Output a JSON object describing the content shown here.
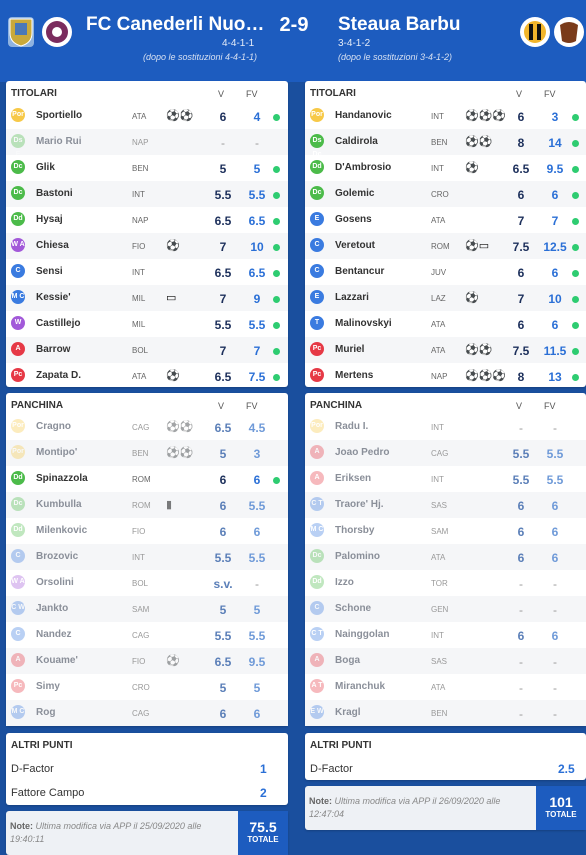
{
  "match": {
    "home": {
      "name": "FC Canederli Nuo…",
      "formation": "4-4-1-1",
      "after_sub": "(dopo le sostituzioni 4-4-1-1)"
    },
    "away": {
      "name": "Steaua Barbu",
      "formation": "3-4-1-2",
      "after_sub": "(dopo le sostituzioni 3-4-1-2)"
    },
    "score": "2-9"
  },
  "labels": {
    "titolari": "TITOLARI",
    "panchina": "PANCHINA",
    "v": "V",
    "fv": "FV",
    "altri_punti": "ALTRI PUNTI",
    "totale": "TOTALE",
    "note_label": "Note:"
  },
  "home_starters": [
    {
      "role": "Por",
      "name": "Sportiello",
      "club": "ATA",
      "icons": "⚽⚽",
      "v": "6",
      "fv": "4",
      "played": true
    },
    {
      "role": "Ds E",
      "name": "Mario Rui",
      "club": "NAP",
      "icons": "",
      "v": "-",
      "fv": "-",
      "played": false
    },
    {
      "role": "Dc",
      "name": "Glik",
      "club": "BEN",
      "icons": "",
      "v": "5",
      "fv": "5",
      "played": true
    },
    {
      "role": "Dc",
      "name": "Bastoni",
      "club": "INT",
      "icons": "",
      "v": "5.5",
      "fv": "5.5",
      "played": true
    },
    {
      "role": "Dd Ds",
      "name": "Hysaj",
      "club": "NAP",
      "icons": "",
      "v": "6.5",
      "fv": "6.5",
      "played": true
    },
    {
      "role": "W A",
      "name": "Chiesa",
      "club": "FIO",
      "icons": "⚽",
      "v": "7",
      "fv": "10",
      "played": true
    },
    {
      "role": "C",
      "name": "Sensi",
      "club": "INT",
      "icons": "",
      "v": "6.5",
      "fv": "6.5",
      "played": true
    },
    {
      "role": "M C",
      "name": "Kessie'",
      "club": "MIL",
      "icons": "▭",
      "v": "7",
      "fv": "9",
      "played": true
    },
    {
      "role": "W",
      "name": "Castillejo",
      "club": "MIL",
      "icons": "",
      "v": "5.5",
      "fv": "5.5",
      "played": true
    },
    {
      "role": "A",
      "name": "Barrow",
      "club": "BOL",
      "icons": "",
      "v": "7",
      "fv": "7",
      "played": true
    },
    {
      "role": "Pc",
      "name": "Zapata D.",
      "club": "ATA",
      "icons": "⚽",
      "v": "6.5",
      "fv": "7.5",
      "played": true
    }
  ],
  "away_starters": [
    {
      "role": "Por",
      "name": "Handanovic",
      "club": "INT",
      "icons": "⚽⚽⚽",
      "v": "6",
      "fv": "3",
      "played": true
    },
    {
      "role": "Ds Dc",
      "name": "Caldirola",
      "club": "BEN",
      "icons": "⚽⚽",
      "v": "8",
      "fv": "14",
      "played": true
    },
    {
      "role": "Dd Dc E",
      "name": "D'Ambrosio",
      "club": "INT",
      "icons": "⚽",
      "v": "6.5",
      "fv": "9.5",
      "played": true
    },
    {
      "role": "Dc",
      "name": "Golemic",
      "club": "CRO",
      "icons": "",
      "v": "6",
      "fv": "6",
      "played": true
    },
    {
      "role": "E",
      "name": "Gosens",
      "club": "ATA",
      "icons": "",
      "v": "7",
      "fv": "7",
      "played": true
    },
    {
      "role": "C",
      "name": "Veretout",
      "club": "ROM",
      "icons": "⚽▭",
      "v": "7.5",
      "fv": "12.5",
      "played": true
    },
    {
      "role": "C",
      "name": "Bentancur",
      "club": "JUV",
      "icons": "",
      "v": "6",
      "fv": "6",
      "played": true
    },
    {
      "role": "E",
      "name": "Lazzari",
      "club": "LAZ",
      "icons": "⚽",
      "v": "7",
      "fv": "10",
      "played": true
    },
    {
      "role": "T",
      "name": "Malinovskyi",
      "club": "ATA",
      "icons": "",
      "v": "6",
      "fv": "6",
      "played": true
    },
    {
      "role": "Pc",
      "name": "Muriel",
      "club": "ATA",
      "icons": "⚽⚽",
      "v": "7.5",
      "fv": "11.5",
      "played": true
    },
    {
      "role": "Pc",
      "name": "Mertens",
      "club": "NAP",
      "icons": "⚽⚽⚽",
      "v": "8",
      "fv": "13",
      "played": true
    }
  ],
  "home_bench": [
    {
      "role": "Por",
      "name": "Cragno",
      "club": "CAG",
      "icons": "⚽⚽",
      "v": "6.5",
      "fv": "4.5",
      "played": false
    },
    {
      "role": "Por",
      "name": "Montipo'",
      "club": "BEN",
      "icons": "⚽⚽",
      "v": "5",
      "fv": "3",
      "played": false
    },
    {
      "role": "Dd Ds",
      "name": "Spinazzola",
      "club": "ROM",
      "icons": "",
      "v": "6",
      "fv": "6",
      "played": true
    },
    {
      "role": "Dc",
      "name": "Kumbulla",
      "club": "ROM",
      "icons": "▮",
      "v": "6",
      "fv": "5.5",
      "played": false
    },
    {
      "role": "Dd",
      "name": "Milenkovic",
      "club": "FIO",
      "icons": "",
      "v": "6",
      "fv": "6",
      "played": false
    },
    {
      "role": "C",
      "name": "Brozovic",
      "club": "INT",
      "icons": "",
      "v": "5.5",
      "fv": "5.5",
      "played": false
    },
    {
      "role": "W A",
      "name": "Orsolini",
      "club": "BOL",
      "icons": "",
      "v": "s.v.",
      "fv": "-",
      "played": false
    },
    {
      "role": "C W",
      "name": "Jankto",
      "club": "SAM",
      "icons": "",
      "v": "5",
      "fv": "5",
      "played": false
    },
    {
      "role": "C",
      "name": "Nandez",
      "club": "CAG",
      "icons": "",
      "v": "5.5",
      "fv": "5.5",
      "played": false
    },
    {
      "role": "A",
      "name": "Kouame'",
      "club": "FIO",
      "icons": "⚽",
      "v": "6.5",
      "fv": "9.5",
      "played": false
    },
    {
      "role": "Pc",
      "name": "Simy",
      "club": "CRO",
      "icons": "",
      "v": "5",
      "fv": "5",
      "played": false
    },
    {
      "role": "M C",
      "name": "Rog",
      "club": "CAG",
      "icons": "",
      "v": "6",
      "fv": "6",
      "played": false
    }
  ],
  "away_bench": [
    {
      "role": "Por",
      "name": "Radu I.",
      "club": "INT",
      "icons": "",
      "v": "-",
      "fv": "-",
      "played": false
    },
    {
      "role": "A",
      "name": "Joao Pedro",
      "club": "CAG",
      "icons": "",
      "v": "5.5",
      "fv": "5.5",
      "played": false
    },
    {
      "role": "A",
      "name": "Eriksen",
      "club": "INT",
      "icons": "",
      "v": "5.5",
      "fv": "5.5",
      "played": false
    },
    {
      "role": "C T",
      "name": "Traore' Hj.",
      "club": "SAS",
      "icons": "",
      "v": "6",
      "fv": "6",
      "played": false
    },
    {
      "role": "M C",
      "name": "Thorsby",
      "club": "SAM",
      "icons": "",
      "v": "6",
      "fv": "6",
      "played": false
    },
    {
      "role": "Dc",
      "name": "Palomino",
      "club": "ATA",
      "icons": "",
      "v": "6",
      "fv": "6",
      "played": false
    },
    {
      "role": "Dd Dc",
      "name": "Izzo",
      "club": "TOR",
      "icons": "",
      "v": "-",
      "fv": "-",
      "played": false
    },
    {
      "role": "C",
      "name": "Schone",
      "club": "GEN",
      "icons": "",
      "v": "-",
      "fv": "-",
      "played": false
    },
    {
      "role": "C T",
      "name": "Nainggolan",
      "club": "INT",
      "icons": "",
      "v": "6",
      "fv": "6",
      "played": false
    },
    {
      "role": "A",
      "name": "Boga",
      "club": "SAS",
      "icons": "",
      "v": "-",
      "fv": "-",
      "played": false
    },
    {
      "role": "A T",
      "name": "Miranchuk",
      "club": "ATA",
      "icons": "",
      "v": "-",
      "fv": "-",
      "played": false
    },
    {
      "role": "E W",
      "name": "Kragl",
      "club": "BEN",
      "icons": "",
      "v": "-",
      "fv": "-",
      "played": false
    }
  ],
  "home_extra": [
    {
      "label": "D-Factor",
      "value": "1"
    },
    {
      "label": "Fattore Campo",
      "value": "2"
    }
  ],
  "away_extra": [
    {
      "label": "D-Factor",
      "value": "2.5"
    }
  ],
  "home_note": "Ultima modifica via APP il 25/09/2020 alle 19:40:11",
  "away_note": "Ultima modifica via APP il 26/09/2020 alle 12:47:04",
  "home_total": "75.5",
  "away_total": "101",
  "colors": {
    "por": "#f7c948",
    "dif": "#4cbb4a",
    "cen": "#3a7be0",
    "att": "#e63946",
    "w": "#a259d9",
    "header": "#1d5cbf",
    "dot": "#2ecc71"
  }
}
